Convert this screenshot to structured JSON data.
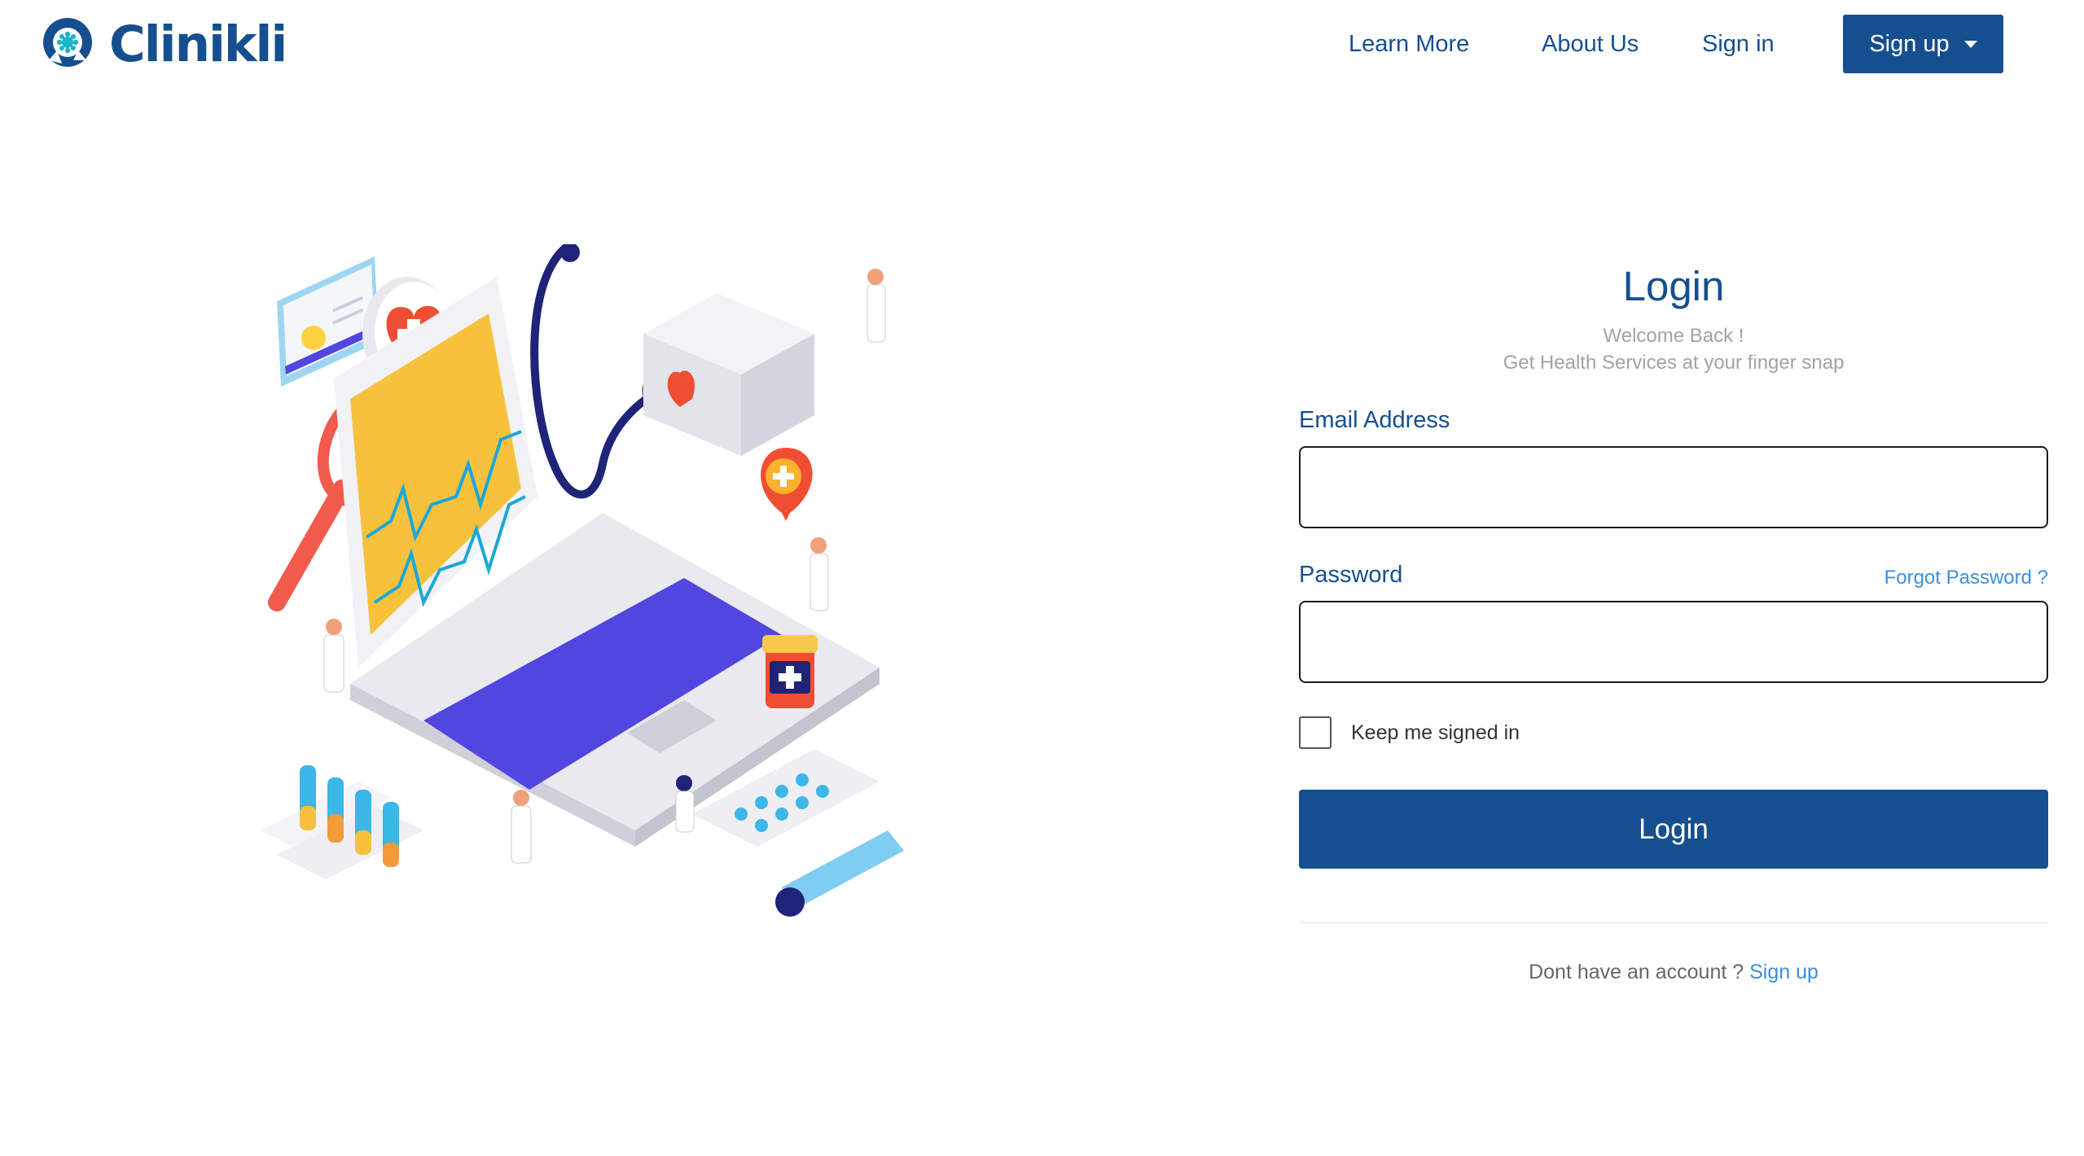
{
  "brand": {
    "name": "Clinikli",
    "color": "#164f8f",
    "accent": "#19b4c9"
  },
  "nav": {
    "learn_more": "Learn More",
    "about_us": "About Us",
    "sign_in": "Sign in",
    "sign_up": "Sign up"
  },
  "illustration": {
    "icon": "medical-laptop-isometric-illustration"
  },
  "login": {
    "title": "Login",
    "welcome": "Welcome Back !",
    "tagline": "Get Health Services at your finger snap",
    "email_label": "Email Address",
    "email_value": "",
    "password_label": "Password",
    "password_value": "",
    "forgot_password": "Forgot Password ?",
    "keep_signed_in": "Keep me signed in",
    "keep_signed_in_checked": false,
    "login_button": "Login",
    "no_account_text": "Dont have an account ?",
    "sign_up_link": "Sign up"
  },
  "colors": {
    "primary": "#164f8f",
    "link": "#3d8fdc",
    "muted_text": "#a3a3a3"
  }
}
